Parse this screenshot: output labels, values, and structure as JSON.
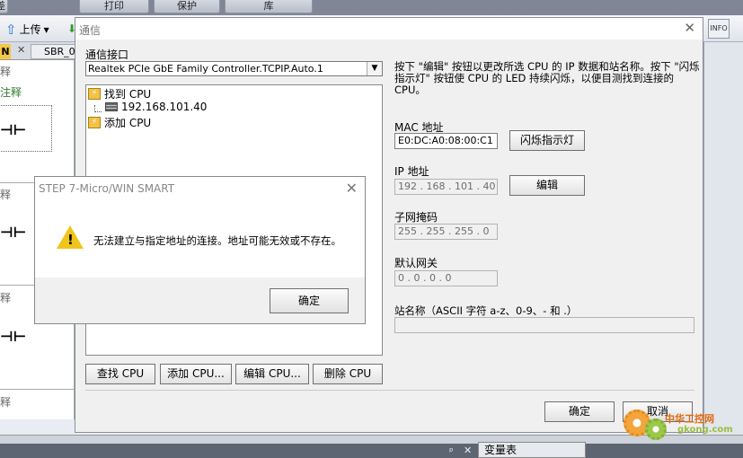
{
  "ribbon": {
    "tabs": [
      "差",
      "打印",
      "保护",
      "库"
    ]
  },
  "toolbar": {
    "upload_label": "上传",
    "upload_dropdown": "▾",
    "right_icon_label": "INFO"
  },
  "left_editor": {
    "tab_marker": "N",
    "tab_close": "✕",
    "tab_sbr": "SBR_0",
    "comment_1": "释",
    "comment_green": "注释",
    "comment_2": "释",
    "comment_3": "释",
    "comment_4": "释",
    "coil_symbol": "⊣⊢"
  },
  "bottom": {
    "pin": "ᵖ",
    "close": "✕",
    "var_table_tab": "变量表"
  },
  "comm_dialog": {
    "title": "通信",
    "close": "✕",
    "interface_label": "通信接口",
    "interface_value": "Realtek PCIe GbE Family Controller.TCPIP.Auto.1",
    "tree": {
      "found_cpu": "找到 CPU",
      "cpu_ip": "192.168.101.40",
      "add_cpu": "添加 CPU"
    },
    "buttons": {
      "find_cpu": "查找 CPU",
      "add_cpu": "添加 CPU...",
      "edit_cpu": "编辑 CPU...",
      "delete_cpu": "删除 CPU",
      "blink": "闪烁指示灯",
      "edit": "编辑",
      "ok": "确定",
      "cancel": "取消"
    },
    "description": "按下 \"编辑\" 按钮以更改所选 CPU 的 IP 数据和站名称。按下 \"闪烁指示灯\" 按钮使 CPU 的 LED 持续闪烁，以便目测找到连接的 CPU。",
    "mac_label": "MAC 地址",
    "mac_value": "E0:DC:A0:08:00:C1",
    "ip_label": "IP 地址",
    "ip_value": "192 . 168 . 101 . 40",
    "subnet_label": "子网掩码",
    "subnet_value": "255 . 255 . 255 . 0",
    "gateway_label": "默认网关",
    "gateway_value": "0 . 0 . 0 . 0",
    "station_label": "站名称（ASCII 字符 a-z、0-9、- 和 .）",
    "station_value": ""
  },
  "error_box": {
    "title": "STEP 7-Micro/WIN SMART",
    "close": "✕",
    "message": "无法建立与指定地址的连接。地址可能无效或不存在。",
    "warning_mark": "!",
    "ok": "确定"
  },
  "watermark": {
    "text": "中华工控网",
    "url": "gkong.com"
  }
}
